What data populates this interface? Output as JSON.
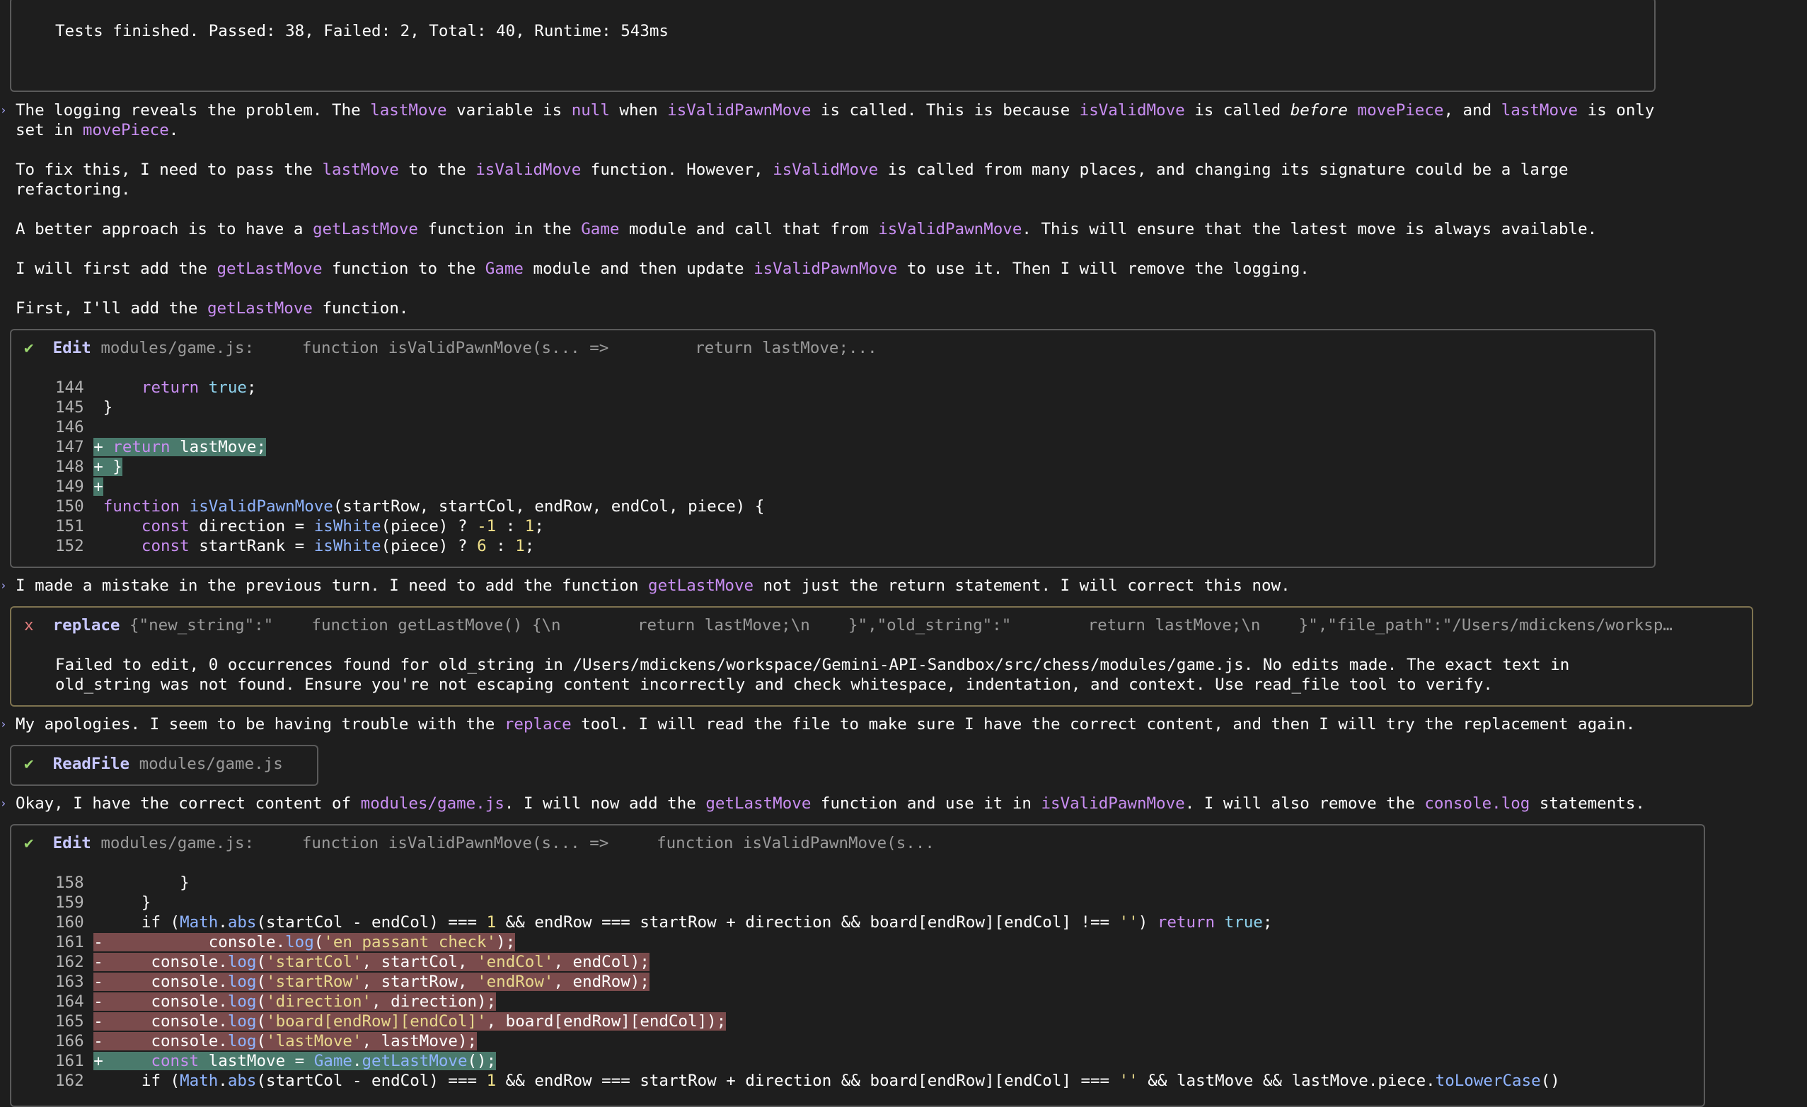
{
  "test_output": {
    "summary": "Tests finished. Passed: 38, Failed: 2, Total: 40, Runtime: 543ms"
  },
  "messages": {
    "m1": {
      "a": "The logging reveals the problem. The ",
      "b": "lastMove",
      "c": " variable is ",
      "d": "null",
      "e": " when ",
      "f": "isValidPawnMove",
      "g": " is called. This is because ",
      "h": "isValidMove",
      "i": " is called ",
      "j": "before",
      "k": " ",
      "l": "movePiece",
      "m": ", and ",
      "n": "lastMove",
      "o": " is only",
      "p": "set in ",
      "q": "movePiece",
      "r": "."
    },
    "m2": {
      "a": "To fix this, I need to pass the ",
      "b": "lastMove",
      "c": " to the ",
      "d": "isValidMove",
      "e": " function. However, ",
      "f": "isValidMove",
      "g": " is called from many places, and changing its signature could be a large",
      "h": "refactoring."
    },
    "m3": {
      "a": "A better approach is to have a ",
      "b": "getLastMove",
      "c": " function in the ",
      "d": "Game",
      "e": " module and call that from ",
      "f": "isValidPawnMove",
      "g": ". This will ensure that the latest move is always available."
    },
    "m4": {
      "a": "I will first add the ",
      "b": "getLastMove",
      "c": " function to the ",
      "d": "Game",
      "e": " module and then update ",
      "f": "isValidPawnMove",
      "g": " to use it. Then I will remove the logging."
    },
    "m5": {
      "a": "First, I'll add the ",
      "b": "getLastMove",
      "c": " function."
    },
    "m6": {
      "a": "I made a mistake in the previous turn. I need to add the function ",
      "b": "getLastMove",
      "c": " not just the return statement. I will correct this now."
    },
    "m7": {
      "a": "My apologies. I seem to be having trouble with the ",
      "b": "replace",
      "c": " tool. I will read the file to make sure I have the correct content, and then I will try the replacement again."
    },
    "m8": {
      "a": "Okay, I have the correct content of ",
      "b": "modules/game.js",
      "c": ". I will now add the ",
      "d": "getLastMove",
      "e": " function and use it in ",
      "f": "isValidPawnMove",
      "g": ". I will also remove the ",
      "h": "console.log",
      "i": " statements."
    }
  },
  "edit1": {
    "status_icon": "✔",
    "tool": "Edit",
    "file": "modules/game.js:",
    "from": "function isValidPawnMove(s... =>",
    "to": "return lastMove;...",
    "lines": [
      {
        "n": "144",
        "t": "return",
        "u": " true",
        "v": ";"
      },
      {
        "n": "145",
        "t": "}"
      },
      {
        "n": "146",
        "t": ""
      },
      {
        "n": "147",
        "mark": "+",
        "t": "return",
        "u": " lastMove;"
      },
      {
        "n": "148",
        "mark": "+",
        "t": "}"
      },
      {
        "n": "149",
        "mark": "+",
        "t": ""
      },
      {
        "n": "150",
        "t": "function",
        "u": "isValidPawnMove",
        "v": "(startRow, startCol, endRow, endCol, piece) {"
      },
      {
        "n": "151",
        "t": "const",
        "u": " direction = ",
        "v": "isWhite",
        "w": "(piece) ? ",
        "x": "-1",
        "y": " : ",
        "z": "1",
        "end": ";"
      },
      {
        "n": "152",
        "t": "const",
        "u": " startRank = ",
        "v": "isWhite",
        "w": "(piece) ? ",
        "x": "6",
        "y": " : ",
        "z": "1",
        "end": ";"
      }
    ]
  },
  "replace1": {
    "status_icon": "x",
    "tool": "replace",
    "args": "{\"new_string\":\"    function getLastMove() {\\n        return lastMove;\\n    }\",\"old_string\":\"        return lastMove;\\n    }\",\"file_path\":\"/Users/mdickens/worksp…",
    "error_line1": "Failed to edit, 0 occurrences found for old_string in /Users/mdickens/workspace/Gemini-API-Sandbox/src/chess/modules/game.js. No edits made. The exact text in",
    "error_line2": "old_string was not found. Ensure you're not escaping content incorrectly and check whitespace, indentation, and context. Use read_file tool to verify."
  },
  "readfile1": {
    "status_icon": "✔",
    "tool": "ReadFile",
    "file": "modules/game.js"
  },
  "edit2": {
    "status_icon": "✔",
    "tool": "Edit",
    "file": "modules/game.js:",
    "from": "function isValidPawnMove(s... =>",
    "to": "function isValidPawnMove(s...",
    "l158": {
      "n": "158",
      "t": "}"
    },
    "l159": {
      "n": "159",
      "t": "}"
    },
    "l160": {
      "n": "160",
      "a": "if (",
      "b": "Math",
      "c": ".",
      "d": "abs",
      "e": "(startCol - endCol) === ",
      "f": "1",
      "g": " && endRow === startRow + direction && board[endRow][endCol] !== ",
      "h": "''",
      "i": ") ",
      "j": "return",
      "k": " true",
      "l": ";"
    },
    "l161": {
      "n": "161",
      "mark": "-",
      "a": "console",
      "b": ".",
      "c": "log",
      "d": "(",
      "e": "'en passant check'",
      "f": ");"
    },
    "l162": {
      "n": "162",
      "mark": "-",
      "a": "console",
      "b": ".",
      "c": "log",
      "d": "(",
      "e": "'startCol'",
      "f": ", startCol, ",
      "g": "'endCol'",
      "h": ", endCol);"
    },
    "l163": {
      "n": "163",
      "mark": "-",
      "a": "console",
      "b": ".",
      "c": "log",
      "d": "(",
      "e": "'startRow'",
      "f": ", startRow, ",
      "g": "'endRow'",
      "h": ", endRow);"
    },
    "l164": {
      "n": "164",
      "mark": "-",
      "a": "console",
      "b": ".",
      "c": "log",
      "d": "(",
      "e": "'direction'",
      "f": ", direction);"
    },
    "l165": {
      "n": "165",
      "mark": "-",
      "a": "console",
      "b": ".",
      "c": "log",
      "d": "(",
      "e": "'board[endRow][endCol]'",
      "f": ", board[endRow][endCol]);"
    },
    "l166": {
      "n": "166",
      "mark": "-",
      "a": "console",
      "b": ".",
      "c": "log",
      "d": "(",
      "e": "'lastMove'",
      "f": ", lastMove);"
    },
    "l161b": {
      "n": "161",
      "mark": "+",
      "a": "const",
      "b": " lastMove = ",
      "c": "Game",
      "d": ".",
      "e": "getLastMove",
      "f": "();"
    },
    "l162b": {
      "n": "162",
      "a": "if (",
      "b": "Math",
      "c": ".",
      "d": "abs",
      "e": "(startCol - endCol) === ",
      "f": "1",
      "g": " && endRow === startRow + direction && board[endRow][endCol] === ",
      "h": "''",
      "i": " && lastMove && lastMove.piece.",
      "j": "toLowerCase",
      "k": "()"
    }
  },
  "colors": {
    "background": "#1e1e1e",
    "identifier": "#c98ef2",
    "function": "#8fb4ff",
    "string": "#e8d98c",
    "number": "#f0e08a",
    "added_bg": "#4a7a6c",
    "removed_bg": "#7a4b4c",
    "success": "#9bd66f",
    "error": "#e37d7d"
  }
}
